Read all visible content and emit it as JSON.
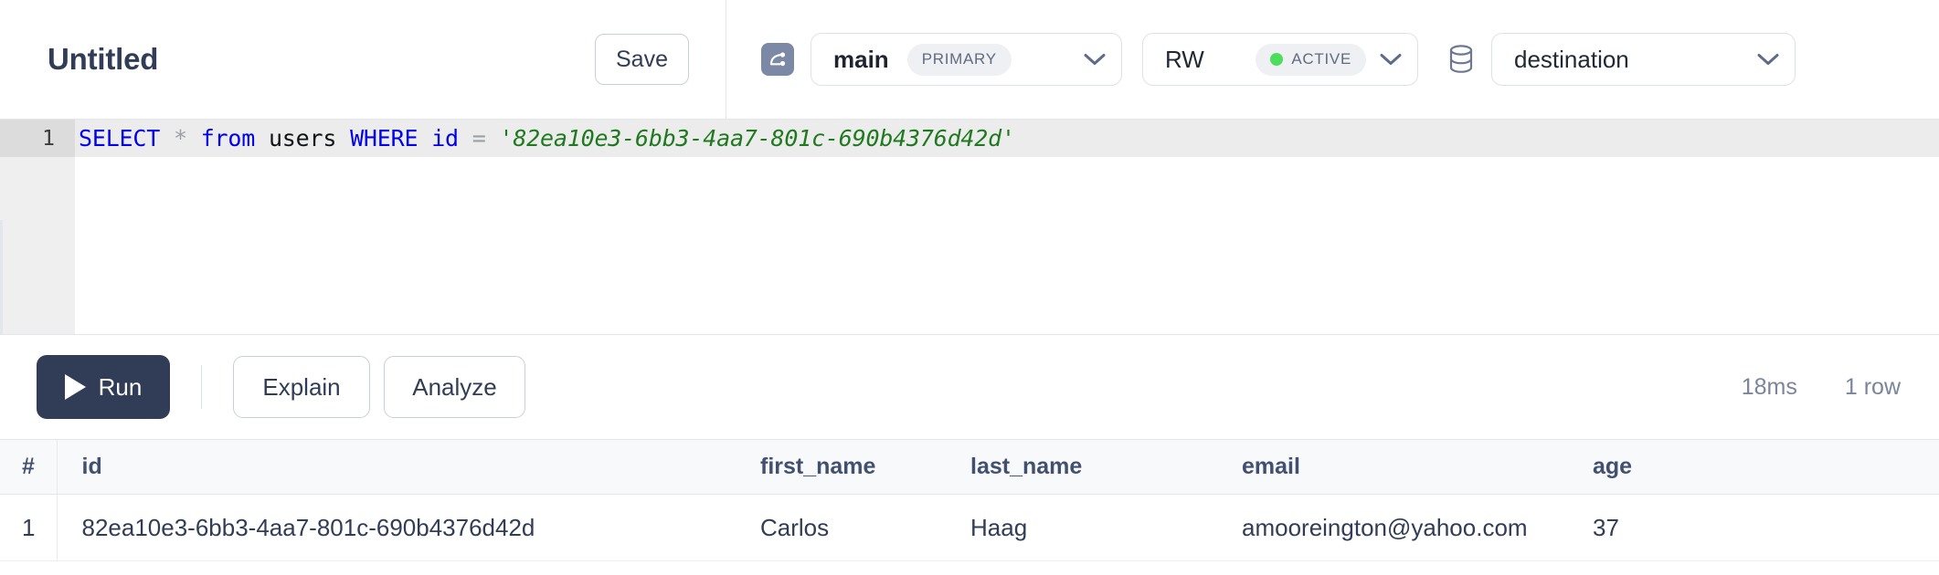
{
  "header": {
    "doc_title": "Untitled",
    "save_label": "Save",
    "branch_icon": "branch-icon",
    "database_icon": "database-icon",
    "chevron_icon": "chevron-down-icon",
    "branch_selector": {
      "value": "main",
      "badge": "PRIMARY"
    },
    "role_selector": {
      "value": "RW",
      "badge": "ACTIVE",
      "status_color": "#4ade5b"
    },
    "database_selector": {
      "value": "destination"
    }
  },
  "editor": {
    "line_number": "1",
    "tokens": {
      "select": "SELECT",
      "star": "*",
      "from": "from",
      "table": "users",
      "where": "WHERE",
      "column": "id",
      "equals": "=",
      "literal": "'82ea10e3-6bb3-4aa7-801c-690b4376d42d'"
    },
    "full_query": "SELECT * from users WHERE id = '82ea10e3-6bb3-4aa7-801c-690b4376d42d'",
    "syntax_colors": {
      "keyword": "#0000ee",
      "operator": "#9aa0a6",
      "identifier": "#101317",
      "string": "#1f7a1f"
    }
  },
  "actions": {
    "run_label": "Run",
    "run_icon": "play-icon",
    "explain_label": "Explain",
    "analyze_label": "Analyze",
    "duration": "18ms",
    "row_count": "1 row",
    "run_button_color": "#313d56"
  },
  "results": {
    "columns": [
      "#",
      "id",
      "first_name",
      "last_name",
      "email",
      "age"
    ],
    "rows": [
      {
        "num": "1",
        "id": "82ea10e3-6bb3-4aa7-801c-690b4376d42d",
        "first_name": "Carlos",
        "last_name": "Haag",
        "email": "amooreington@yahoo.com",
        "age": "37"
      }
    ]
  }
}
